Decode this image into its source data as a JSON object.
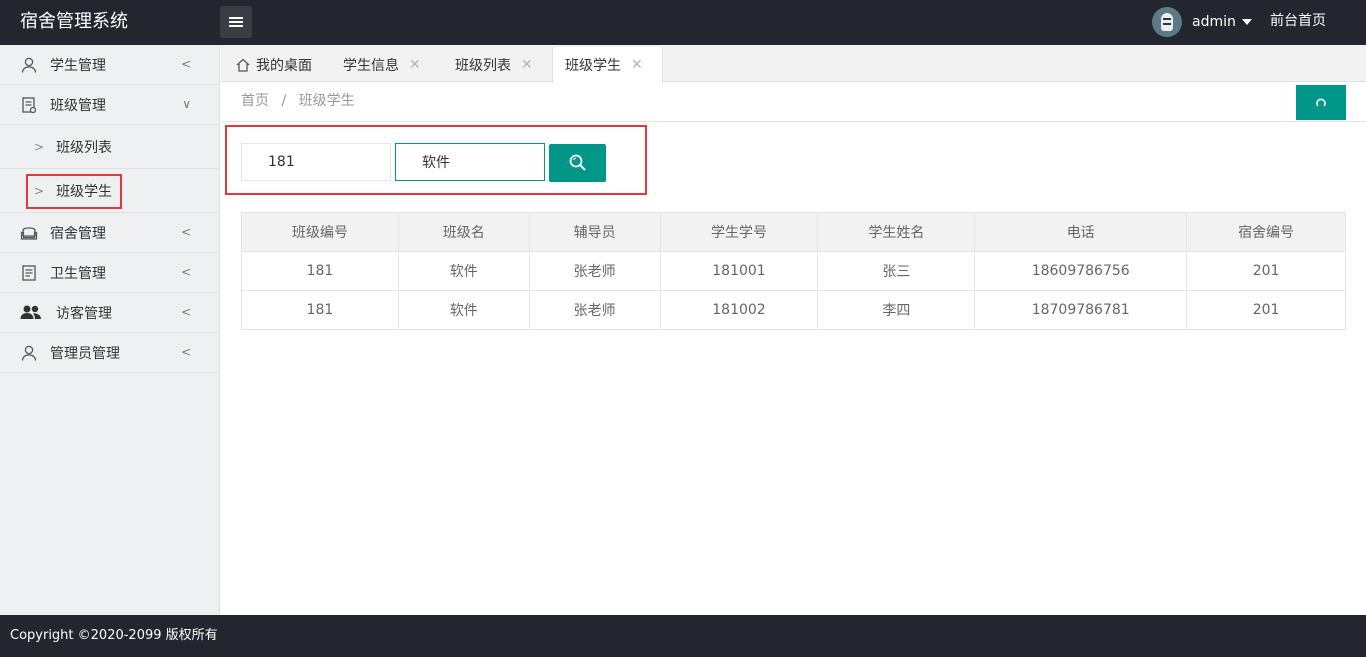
{
  "app": {
    "title": "宿舍管理系统"
  },
  "header": {
    "user_name": "admin",
    "front_link": "前台首页"
  },
  "sidebar": {
    "items": [
      {
        "label": "学生管理",
        "arrow": "<"
      },
      {
        "label": "班级管理",
        "arrow": "∨",
        "children": [
          {
            "label": "班级列表"
          },
          {
            "label": "班级学生"
          }
        ]
      },
      {
        "label": "宿舍管理",
        "arrow": "<"
      },
      {
        "label": "卫生管理",
        "arrow": "<"
      },
      {
        "label": "访客管理",
        "arrow": "<"
      },
      {
        "label": "管理员管理",
        "arrow": "<"
      }
    ],
    "chevron": ">"
  },
  "tabs": [
    {
      "label": "我的桌面"
    },
    {
      "label": "学生信息",
      "close": "✕"
    },
    {
      "label": "班级列表",
      "close": "✕"
    },
    {
      "label": "班级学生",
      "close": "✕"
    }
  ],
  "breadcrumb": {
    "home": "首页",
    "sep": "/",
    "current": "班级学生"
  },
  "search": {
    "class_id_value": "181",
    "class_name_value": "软件"
  },
  "table": {
    "headers": [
      "班级编号",
      "班级名",
      "辅导员",
      "学生学号",
      "学生姓名",
      "电话",
      "宿舍编号"
    ],
    "rows": [
      [
        "181",
        "软件",
        "张老师",
        "181001",
        "张三",
        "18609786756",
        "201"
      ],
      [
        "181",
        "软件",
        "张老师",
        "181002",
        "李四",
        "18709786781",
        "201"
      ]
    ]
  },
  "footer": {
    "text": "Copyright ©2020-2099 版权所有"
  },
  "colors": {
    "accent": "#009688",
    "header_bg": "#23262e",
    "highlight": "#e0393e"
  }
}
